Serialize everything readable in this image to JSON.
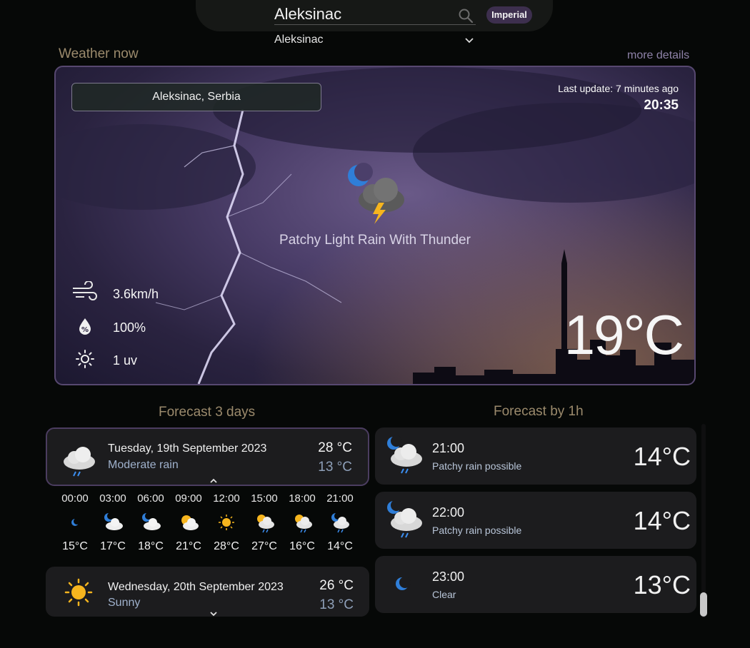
{
  "search": {
    "value": "Aleksinac",
    "unit_toggle": "Imperial",
    "selected_city": "Aleksinac"
  },
  "weather_now": {
    "section_title": "Weather now",
    "more_details": "more details",
    "location": "Aleksinac, Serbia",
    "last_update": "Last update: 7 minutes ago",
    "time": "20:35",
    "condition": "Patchy Light Rain With Thunder",
    "condition_icon": "moon-cloud-thunder-icon",
    "wind": "3.6km/h",
    "humidity": "100%",
    "uv": "1 uv",
    "temperature": "19°C"
  },
  "forecast_days": {
    "title": "Forecast 3 days",
    "days": [
      {
        "date": "Tuesday, 19th September 2023",
        "desc": "Moderate rain",
        "max": "28 °C",
        "min": "13 °C",
        "icon": "cloud-rain-icon",
        "hours": [
          {
            "time": "00:00",
            "temp": "15°C",
            "icon": "moon-icon"
          },
          {
            "time": "03:00",
            "temp": "17°C",
            "icon": "moon-cloud-icon"
          },
          {
            "time": "06:00",
            "temp": "18°C",
            "icon": "moon-cloud-icon"
          },
          {
            "time": "09:00",
            "temp": "21°C",
            "icon": "sun-cloud-icon"
          },
          {
            "time": "12:00",
            "temp": "28°C",
            "icon": "sun-icon"
          },
          {
            "time": "15:00",
            "temp": "27°C",
            "icon": "sun-cloud-rain-icon"
          },
          {
            "time": "18:00",
            "temp": "16°C",
            "icon": "sun-cloud-rain-icon"
          },
          {
            "time": "21:00",
            "temp": "14°C",
            "icon": "moon-cloud-rain-icon"
          }
        ]
      },
      {
        "date": "Wednesday, 20th September 2023",
        "desc": "Sunny",
        "max": "26 °C",
        "min": "13 °C",
        "icon": "sun-icon"
      }
    ]
  },
  "forecast_hours": {
    "title": "Forecast by 1h",
    "items": [
      {
        "time": "21:00",
        "desc": "Patchy rain possible",
        "temp": "14°C",
        "icon": "moon-cloud-rain-icon"
      },
      {
        "time": "22:00",
        "desc": "Patchy rain possible",
        "temp": "14°C",
        "icon": "moon-cloud-rain-icon"
      },
      {
        "time": "23:00",
        "desc": "Clear",
        "temp": "13°C",
        "icon": "moon-icon"
      }
    ]
  },
  "colors": {
    "background": "#060807",
    "accent_purple": "#574870",
    "section_title": "#9b8a6c"
  }
}
